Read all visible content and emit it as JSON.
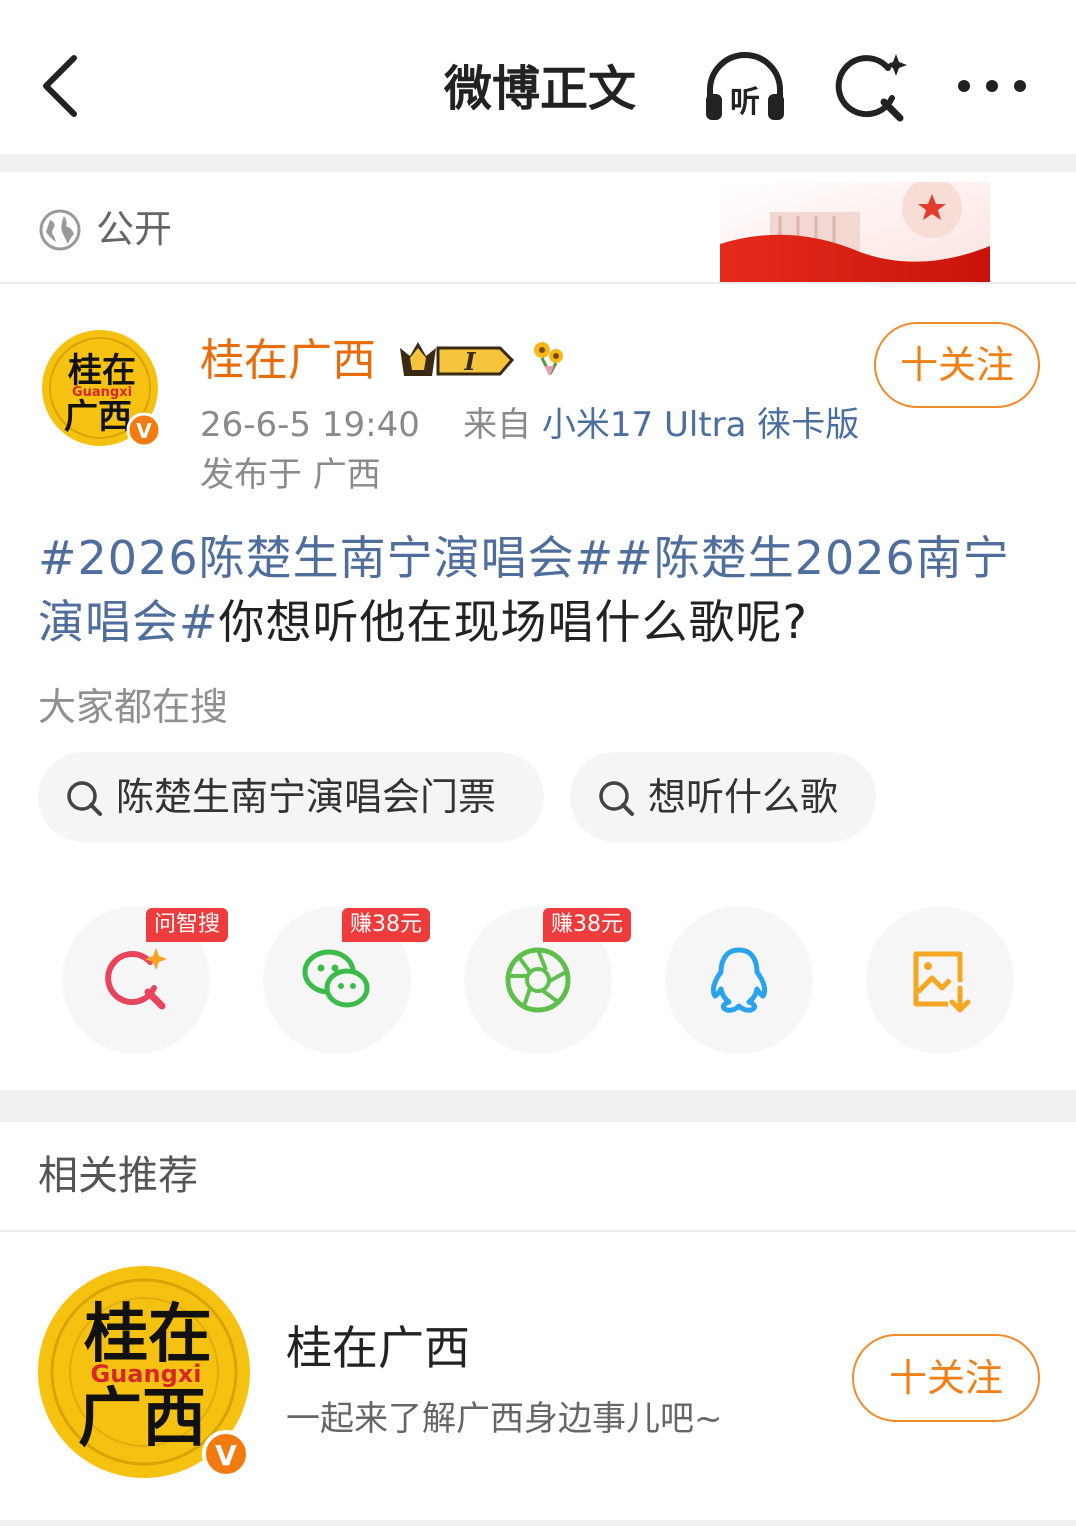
{
  "header": {
    "title": "微博正文",
    "listen_label": "听"
  },
  "visibility": {
    "label": "公开"
  },
  "author": {
    "name": "桂在广西",
    "badge_level": "I",
    "avatar_text_top": "桂在",
    "avatar_text_mid": "Guangxi",
    "avatar_text_bottom": "广西",
    "verified_mark": "V",
    "follow_label": "十关注",
    "timestamp": "26-6-5 19:40",
    "source_prefix": "来自",
    "source": "小米17 Ultra 徕卡版",
    "location": "发布于 广西"
  },
  "post": {
    "tag1": "#2026陈楚生南宁演唱会#",
    "tag2": "#陈楚生2026南宁演唱会#",
    "text": "你想听他在现场唱什么歌呢?"
  },
  "hot_search": {
    "label": "大家都在搜",
    "chips": [
      "陈楚生南宁演唱会门票",
      "想听什么歌"
    ]
  },
  "share": {
    "items": [
      {
        "icon": "ai-search-icon",
        "tag": "问智搜"
      },
      {
        "icon": "wechat-icon",
        "tag": "赚38元"
      },
      {
        "icon": "moments-icon",
        "tag": "赚38元"
      },
      {
        "icon": "qq-icon",
        "tag": ""
      },
      {
        "icon": "save-image-icon",
        "tag": ""
      }
    ]
  },
  "recommend": {
    "title": "相关推荐",
    "name": "桂在广西",
    "desc": "一起来了解广西身边事儿吧~",
    "follow_label": "十关注"
  },
  "colors": {
    "accent_orange": "#f07f15",
    "link_blue": "#4f6e9c",
    "tag_red": "#ee3b3b",
    "avatar_yellow": "#f5c211"
  }
}
